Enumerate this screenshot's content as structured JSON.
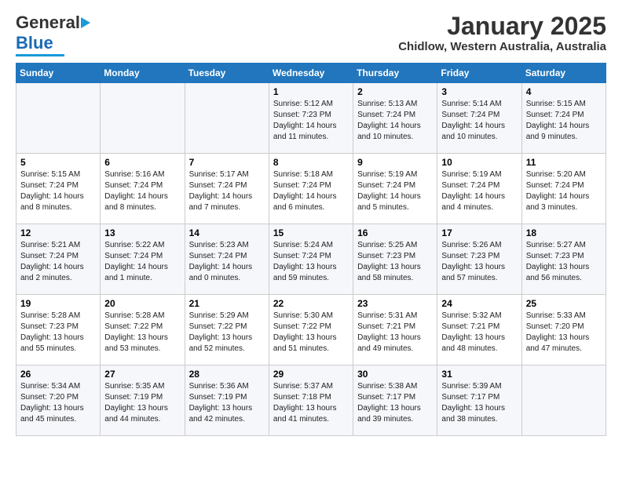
{
  "logo": {
    "general": "General",
    "blue": "Blue"
  },
  "header": {
    "month": "January 2025",
    "location": "Chidlow, Western Australia, Australia"
  },
  "weekdays": [
    "Sunday",
    "Monday",
    "Tuesday",
    "Wednesday",
    "Thursday",
    "Friday",
    "Saturday"
  ],
  "weeks": [
    [
      {
        "day": "",
        "sunrise": "",
        "sunset": "",
        "daylight": ""
      },
      {
        "day": "",
        "sunrise": "",
        "sunset": "",
        "daylight": ""
      },
      {
        "day": "",
        "sunrise": "",
        "sunset": "",
        "daylight": ""
      },
      {
        "day": "1",
        "sunrise": "Sunrise: 5:12 AM",
        "sunset": "Sunset: 7:23 PM",
        "daylight": "Daylight: 14 hours and 11 minutes."
      },
      {
        "day": "2",
        "sunrise": "Sunrise: 5:13 AM",
        "sunset": "Sunset: 7:24 PM",
        "daylight": "Daylight: 14 hours and 10 minutes."
      },
      {
        "day": "3",
        "sunrise": "Sunrise: 5:14 AM",
        "sunset": "Sunset: 7:24 PM",
        "daylight": "Daylight: 14 hours and 10 minutes."
      },
      {
        "day": "4",
        "sunrise": "Sunrise: 5:15 AM",
        "sunset": "Sunset: 7:24 PM",
        "daylight": "Daylight: 14 hours and 9 minutes."
      }
    ],
    [
      {
        "day": "5",
        "sunrise": "Sunrise: 5:15 AM",
        "sunset": "Sunset: 7:24 PM",
        "daylight": "Daylight: 14 hours and 8 minutes."
      },
      {
        "day": "6",
        "sunrise": "Sunrise: 5:16 AM",
        "sunset": "Sunset: 7:24 PM",
        "daylight": "Daylight: 14 hours and 8 minutes."
      },
      {
        "day": "7",
        "sunrise": "Sunrise: 5:17 AM",
        "sunset": "Sunset: 7:24 PM",
        "daylight": "Daylight: 14 hours and 7 minutes."
      },
      {
        "day": "8",
        "sunrise": "Sunrise: 5:18 AM",
        "sunset": "Sunset: 7:24 PM",
        "daylight": "Daylight: 14 hours and 6 minutes."
      },
      {
        "day": "9",
        "sunrise": "Sunrise: 5:19 AM",
        "sunset": "Sunset: 7:24 PM",
        "daylight": "Daylight: 14 hours and 5 minutes."
      },
      {
        "day": "10",
        "sunrise": "Sunrise: 5:19 AM",
        "sunset": "Sunset: 7:24 PM",
        "daylight": "Daylight: 14 hours and 4 minutes."
      },
      {
        "day": "11",
        "sunrise": "Sunrise: 5:20 AM",
        "sunset": "Sunset: 7:24 PM",
        "daylight": "Daylight: 14 hours and 3 minutes."
      }
    ],
    [
      {
        "day": "12",
        "sunrise": "Sunrise: 5:21 AM",
        "sunset": "Sunset: 7:24 PM",
        "daylight": "Daylight: 14 hours and 2 minutes."
      },
      {
        "day": "13",
        "sunrise": "Sunrise: 5:22 AM",
        "sunset": "Sunset: 7:24 PM",
        "daylight": "Daylight: 14 hours and 1 minute."
      },
      {
        "day": "14",
        "sunrise": "Sunrise: 5:23 AM",
        "sunset": "Sunset: 7:24 PM",
        "daylight": "Daylight: 14 hours and 0 minutes."
      },
      {
        "day": "15",
        "sunrise": "Sunrise: 5:24 AM",
        "sunset": "Sunset: 7:24 PM",
        "daylight": "Daylight: 13 hours and 59 minutes."
      },
      {
        "day": "16",
        "sunrise": "Sunrise: 5:25 AM",
        "sunset": "Sunset: 7:23 PM",
        "daylight": "Daylight: 13 hours and 58 minutes."
      },
      {
        "day": "17",
        "sunrise": "Sunrise: 5:26 AM",
        "sunset": "Sunset: 7:23 PM",
        "daylight": "Daylight: 13 hours and 57 minutes."
      },
      {
        "day": "18",
        "sunrise": "Sunrise: 5:27 AM",
        "sunset": "Sunset: 7:23 PM",
        "daylight": "Daylight: 13 hours and 56 minutes."
      }
    ],
    [
      {
        "day": "19",
        "sunrise": "Sunrise: 5:28 AM",
        "sunset": "Sunset: 7:23 PM",
        "daylight": "Daylight: 13 hours and 55 minutes."
      },
      {
        "day": "20",
        "sunrise": "Sunrise: 5:28 AM",
        "sunset": "Sunset: 7:22 PM",
        "daylight": "Daylight: 13 hours and 53 minutes."
      },
      {
        "day": "21",
        "sunrise": "Sunrise: 5:29 AM",
        "sunset": "Sunset: 7:22 PM",
        "daylight": "Daylight: 13 hours and 52 minutes."
      },
      {
        "day": "22",
        "sunrise": "Sunrise: 5:30 AM",
        "sunset": "Sunset: 7:22 PM",
        "daylight": "Daylight: 13 hours and 51 minutes."
      },
      {
        "day": "23",
        "sunrise": "Sunrise: 5:31 AM",
        "sunset": "Sunset: 7:21 PM",
        "daylight": "Daylight: 13 hours and 49 minutes."
      },
      {
        "day": "24",
        "sunrise": "Sunrise: 5:32 AM",
        "sunset": "Sunset: 7:21 PM",
        "daylight": "Daylight: 13 hours and 48 minutes."
      },
      {
        "day": "25",
        "sunrise": "Sunrise: 5:33 AM",
        "sunset": "Sunset: 7:20 PM",
        "daylight": "Daylight: 13 hours and 47 minutes."
      }
    ],
    [
      {
        "day": "26",
        "sunrise": "Sunrise: 5:34 AM",
        "sunset": "Sunset: 7:20 PM",
        "daylight": "Daylight: 13 hours and 45 minutes."
      },
      {
        "day": "27",
        "sunrise": "Sunrise: 5:35 AM",
        "sunset": "Sunset: 7:19 PM",
        "daylight": "Daylight: 13 hours and 44 minutes."
      },
      {
        "day": "28",
        "sunrise": "Sunrise: 5:36 AM",
        "sunset": "Sunset: 7:19 PM",
        "daylight": "Daylight: 13 hours and 42 minutes."
      },
      {
        "day": "29",
        "sunrise": "Sunrise: 5:37 AM",
        "sunset": "Sunset: 7:18 PM",
        "daylight": "Daylight: 13 hours and 41 minutes."
      },
      {
        "day": "30",
        "sunrise": "Sunrise: 5:38 AM",
        "sunset": "Sunset: 7:17 PM",
        "daylight": "Daylight: 13 hours and 39 minutes."
      },
      {
        "day": "31",
        "sunrise": "Sunrise: 5:39 AM",
        "sunset": "Sunset: 7:17 PM",
        "daylight": "Daylight: 13 hours and 38 minutes."
      },
      {
        "day": "",
        "sunrise": "",
        "sunset": "",
        "daylight": ""
      }
    ]
  ]
}
